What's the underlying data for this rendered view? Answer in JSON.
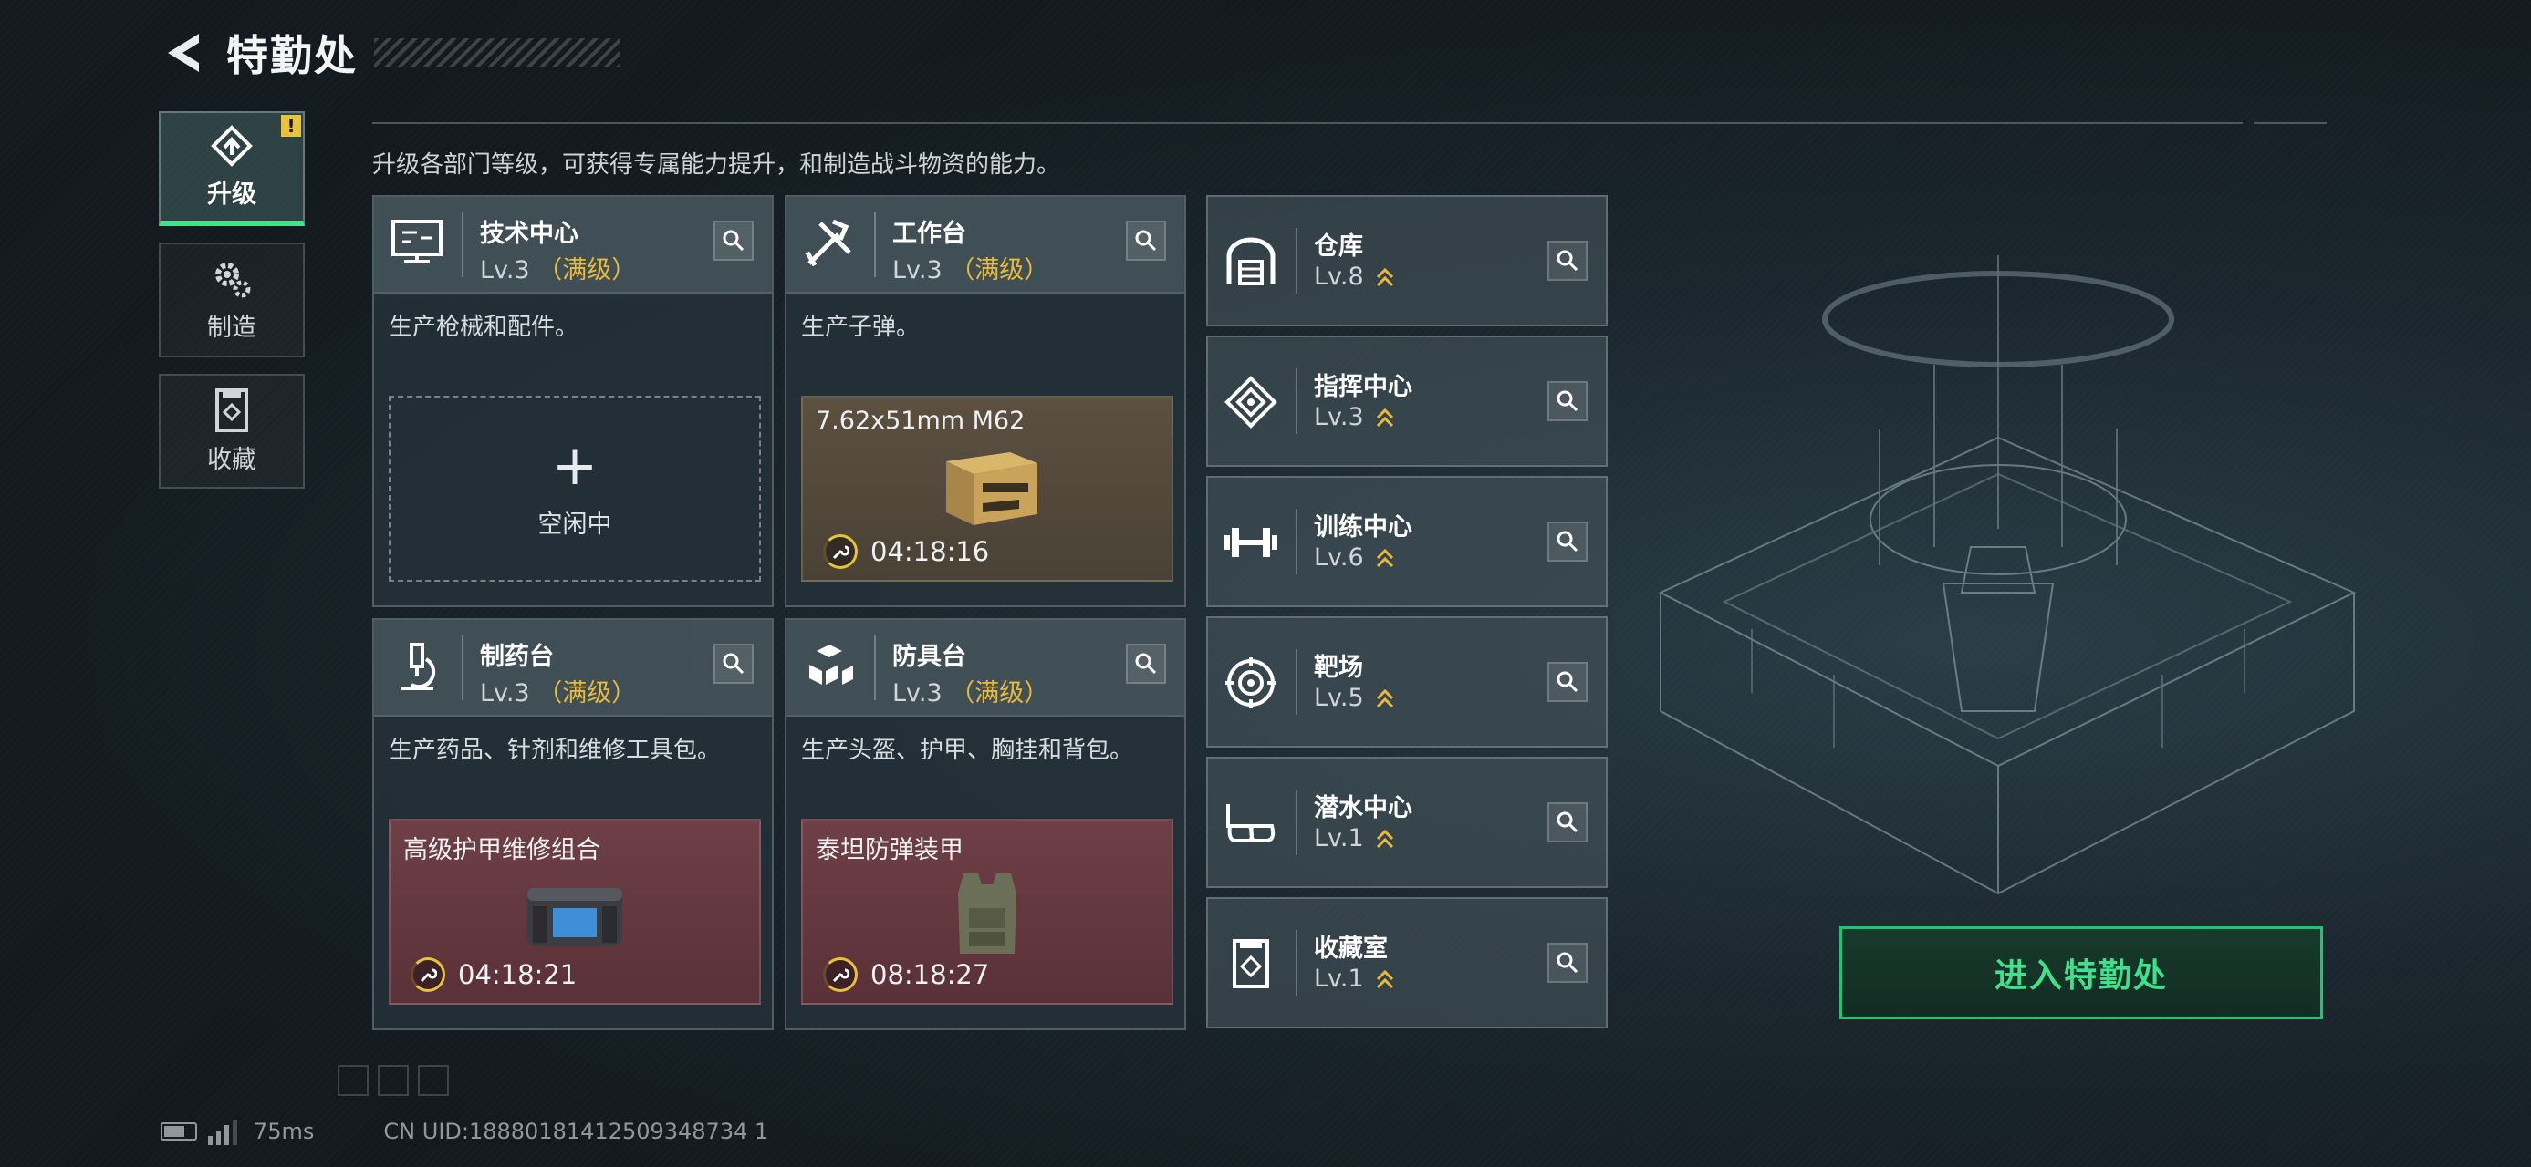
{
  "header": {
    "title": "特勤处"
  },
  "sidebar": {
    "tabs": [
      {
        "label": "升级",
        "icon": "upgrade-icon",
        "active": true,
        "badge": "!"
      },
      {
        "label": "制造",
        "icon": "gear-icon",
        "active": false
      },
      {
        "label": "收藏",
        "icon": "collection-icon",
        "active": false
      }
    ]
  },
  "description": "升级各部门等级，可获得专属能力提升，和制造战斗物资的能力。",
  "cards": [
    {
      "name": "技术中心",
      "level": "Lv.3",
      "max": "（满级）",
      "desc": "生产枪械和配件。",
      "icon": "computer-icon",
      "slot": {
        "state": "idle",
        "plus": "+",
        "label": "空闲中"
      }
    },
    {
      "name": "工作台",
      "level": "Lv.3",
      "max": "（满级）",
      "desc": "生产子弹。",
      "icon": "tools-icon",
      "slot": {
        "state": "producing",
        "item": "7.62x51mm M62",
        "timer": "04:18:16"
      }
    },
    {
      "name": "制药台",
      "level": "Lv.3",
      "max": "（满级）",
      "desc": "生产药品、针剂和维修工具包。",
      "icon": "microscope-icon",
      "slot": {
        "state": "producing",
        "item": "高级护甲维修组合",
        "timer": "04:18:21"
      }
    },
    {
      "name": "防具台",
      "level": "Lv.3",
      "max": "（满级）",
      "desc": "生产头盔、护甲、胸挂和背包。",
      "icon": "cubes-icon",
      "slot": {
        "state": "producing",
        "item": "泰坦防弹装甲",
        "timer": "08:18:27"
      }
    }
  ],
  "rooms": [
    {
      "name": "仓库",
      "level": "Lv.8",
      "icon": "warehouse-icon"
    },
    {
      "name": "指挥中心",
      "level": "Lv.3",
      "icon": "command-icon"
    },
    {
      "name": "训练中心",
      "level": "Lv.6",
      "icon": "dumbbell-icon"
    },
    {
      "name": "靶场",
      "level": "Lv.5",
      "icon": "target-icon"
    },
    {
      "name": "潜水中心",
      "level": "Lv.1",
      "icon": "diving-mask-icon"
    },
    {
      "name": "收藏室",
      "level": "Lv.1",
      "icon": "collection-room-icon"
    }
  ],
  "enter_button": "进入特勤处",
  "status_bar": {
    "ping": "75ms",
    "uid": "CN UID:18880181412509348734 1"
  },
  "colors": {
    "accent_green": "#3fe28c",
    "max_level_gold": "#e8b93a",
    "badge_yellow": "#e8c23a"
  }
}
